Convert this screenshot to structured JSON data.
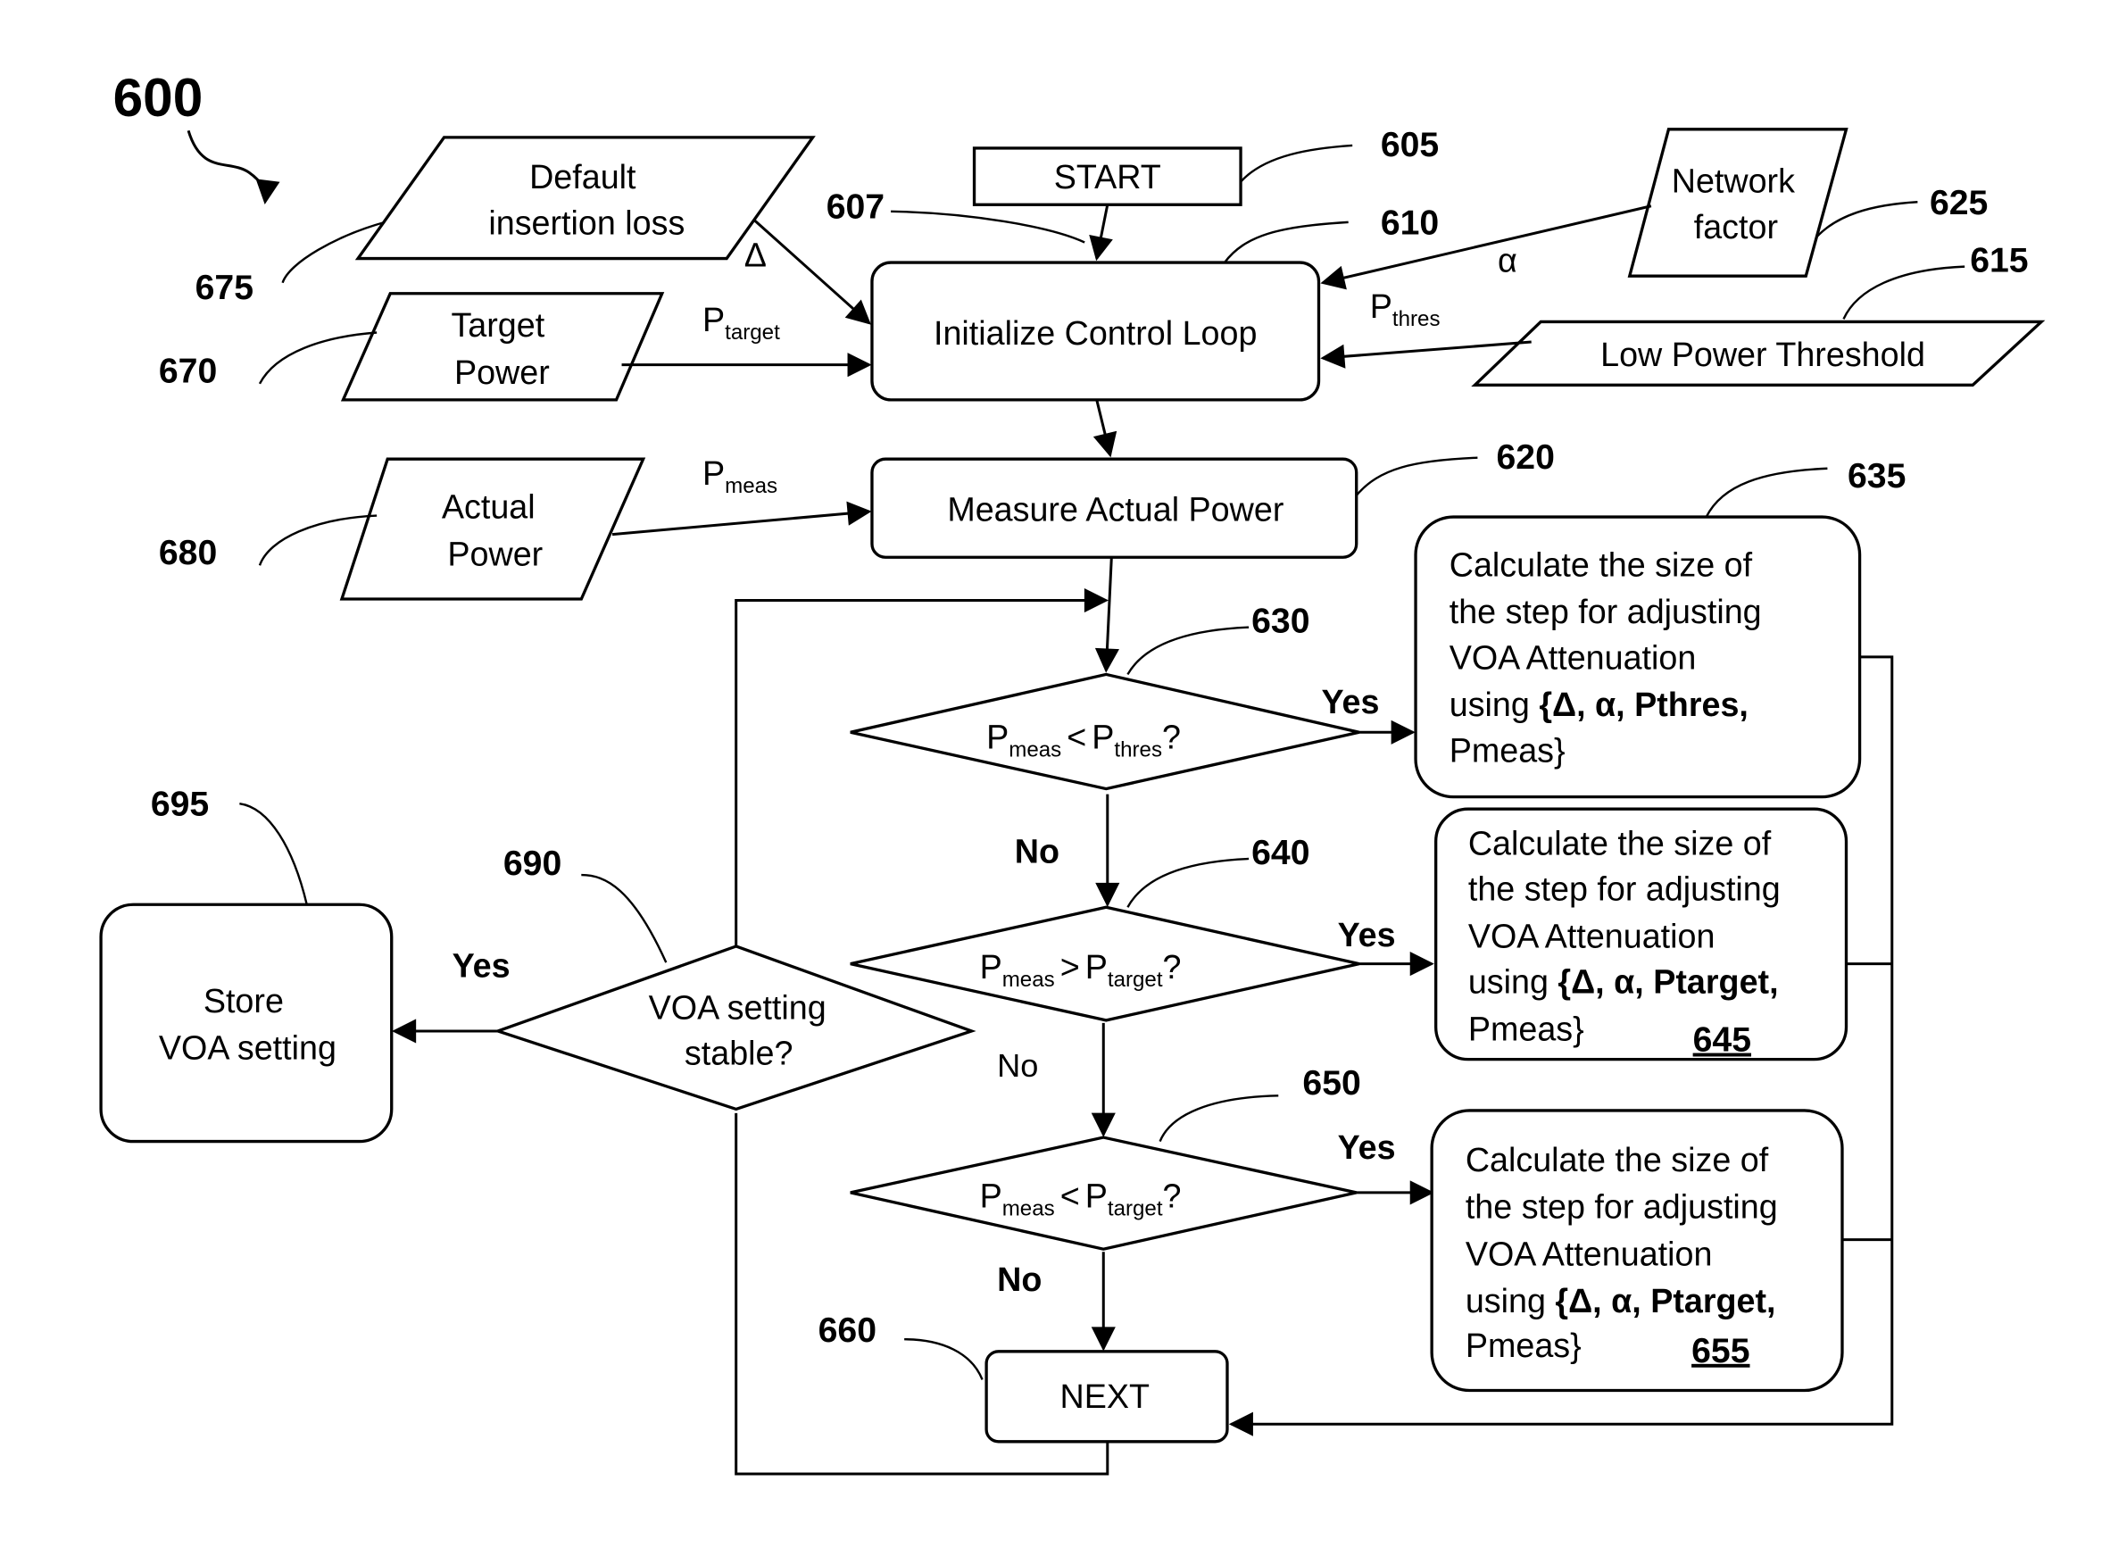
{
  "figure": {
    "ref": "600"
  },
  "nodes": {
    "start": {
      "ref": "605",
      "label": "START"
    },
    "init": {
      "ref": "610",
      "label": "Initialize Control Loop"
    },
    "init_arrow_ref": "607",
    "low_power_threshold": {
      "ref": "615",
      "label": "Low Power Threshold"
    },
    "measure": {
      "ref": "620",
      "label": "Measure Actual Power"
    },
    "network_factor": {
      "ref": "625",
      "lines": [
        "Network",
        "factor"
      ]
    },
    "default_insertion_loss": {
      "ref": "675",
      "lines": [
        "Default",
        "insertion loss"
      ]
    },
    "target_power": {
      "ref": "670",
      "lines": [
        "Target",
        "Power"
      ]
    },
    "actual_power": {
      "ref": "680",
      "lines": [
        "Actual",
        "Power"
      ]
    },
    "decision_thres": {
      "ref": "630",
      "lhs": "P",
      "lhs_sub": "meas",
      "op": "<",
      "rhs": "P",
      "rhs_sub": "thres",
      "q": "?"
    },
    "decision_gt_target": {
      "ref": "640",
      "lhs": "P",
      "lhs_sub": "meas",
      "op": ">",
      "rhs": "P",
      "rhs_sub": "target",
      "q": "?"
    },
    "decision_lt_target": {
      "ref": "650",
      "lhs": "P",
      "lhs_sub": "meas",
      "op": "<",
      "rhs": "P",
      "rhs_sub": "target",
      "q": "?"
    },
    "calc_thres": {
      "ref": "635",
      "lines": [
        "Calculate the size of",
        "the step for adjusting",
        "VOA Attenuation"
      ],
      "using_prefix": "using ",
      "using_bold": "{Δ, α, Pthres,",
      "last_line": "Pmeas}"
    },
    "calc_gt_target": {
      "ref": "645",
      "lines": [
        "Calculate the size of",
        "the step for adjusting",
        "VOA Attenuation"
      ],
      "using_prefix": "using ",
      "using_bold": "{Δ, α, Ptarget,",
      "last_line": "Pmeas}"
    },
    "calc_lt_target": {
      "ref": "655",
      "lines": [
        "Calculate the size of",
        "the step for adjusting",
        "VOA Attenuation"
      ],
      "using_prefix": "using ",
      "using_bold": "{Δ, α, Ptarget,",
      "last_line": "Pmeas}"
    },
    "next": {
      "ref": "660",
      "label": "NEXT"
    },
    "voa_stable": {
      "ref": "690",
      "lines": [
        "VOA setting",
        "stable?"
      ]
    },
    "store_voa": {
      "ref": "695",
      "lines": [
        "Store",
        "VOA setting"
      ]
    }
  },
  "edges": {
    "delta": "Δ",
    "alpha": "α",
    "p_target": {
      "main": "P",
      "sub": "target"
    },
    "p_thres": {
      "main": "P",
      "sub": "thres"
    },
    "p_meas": {
      "main": "P",
      "sub": "meas"
    },
    "yes": "Yes",
    "no": "No"
  }
}
